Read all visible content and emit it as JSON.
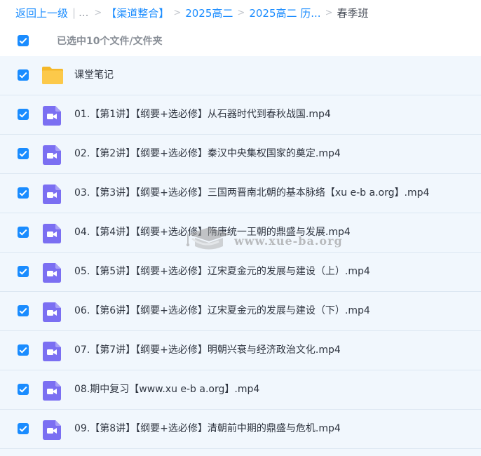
{
  "breadcrumb": {
    "back_label": "返回上一级",
    "ellipsis": "...",
    "items": [
      {
        "label": "【渠道整合】"
      },
      {
        "label": "2025高二"
      },
      {
        "label": "2025高二 历..."
      }
    ],
    "current": "春季班"
  },
  "selection": {
    "checked": true,
    "label": "已选中10个文件/文件夹"
  },
  "files": [
    {
      "type": "folder",
      "icon": "folder-icon",
      "checked": true,
      "name": "课堂笔记"
    },
    {
      "type": "video",
      "icon": "video-icon",
      "checked": true,
      "name": "01.【第1讲】【纲要+选必修】从石器时代到春秋战国.mp4"
    },
    {
      "type": "video",
      "icon": "video-icon",
      "checked": true,
      "name": "02.【第2讲】【纲要+选必修】秦汉中央集权国家的奠定.mp4"
    },
    {
      "type": "video",
      "icon": "video-icon",
      "checked": true,
      "name": "03.【第3讲】【纲要+选必修】三国两晋南北朝的基本脉络【xu e-b a.org】.mp4"
    },
    {
      "type": "video",
      "icon": "video-icon",
      "checked": true,
      "name": "04.【第4讲】【纲要+选必修】隋唐统一王朝的鼎盛与发展.mp4"
    },
    {
      "type": "video",
      "icon": "video-icon",
      "checked": true,
      "name": "05.【第5讲】【纲要+选必修】辽宋夏金元的发展与建设（上）.mp4"
    },
    {
      "type": "video",
      "icon": "video-icon",
      "checked": true,
      "name": "06.【第6讲】【纲要+选必修】辽宋夏金元的发展与建设（下）.mp4"
    },
    {
      "type": "video",
      "icon": "video-icon",
      "checked": true,
      "name": "07.【第7讲】【纲要+选必修】明朝兴衰与经济政治文化.mp4"
    },
    {
      "type": "video",
      "icon": "video-icon",
      "checked": true,
      "name": "08.期中复习【www.xu e-b a.org】.mp4"
    },
    {
      "type": "video",
      "icon": "video-icon",
      "checked": true,
      "name": "09.【第8讲】【纲要+选必修】清朝前中期的鼎盛与危机.mp4"
    }
  ],
  "watermark": {
    "text": "www.xue-ba.org",
    "icon": "mortarboard-icon"
  },
  "colors": {
    "accent": "#1a8cff",
    "row_bg": "#f1f7fd",
    "folder": "#fcc94a",
    "video": "#7b6ff2"
  }
}
